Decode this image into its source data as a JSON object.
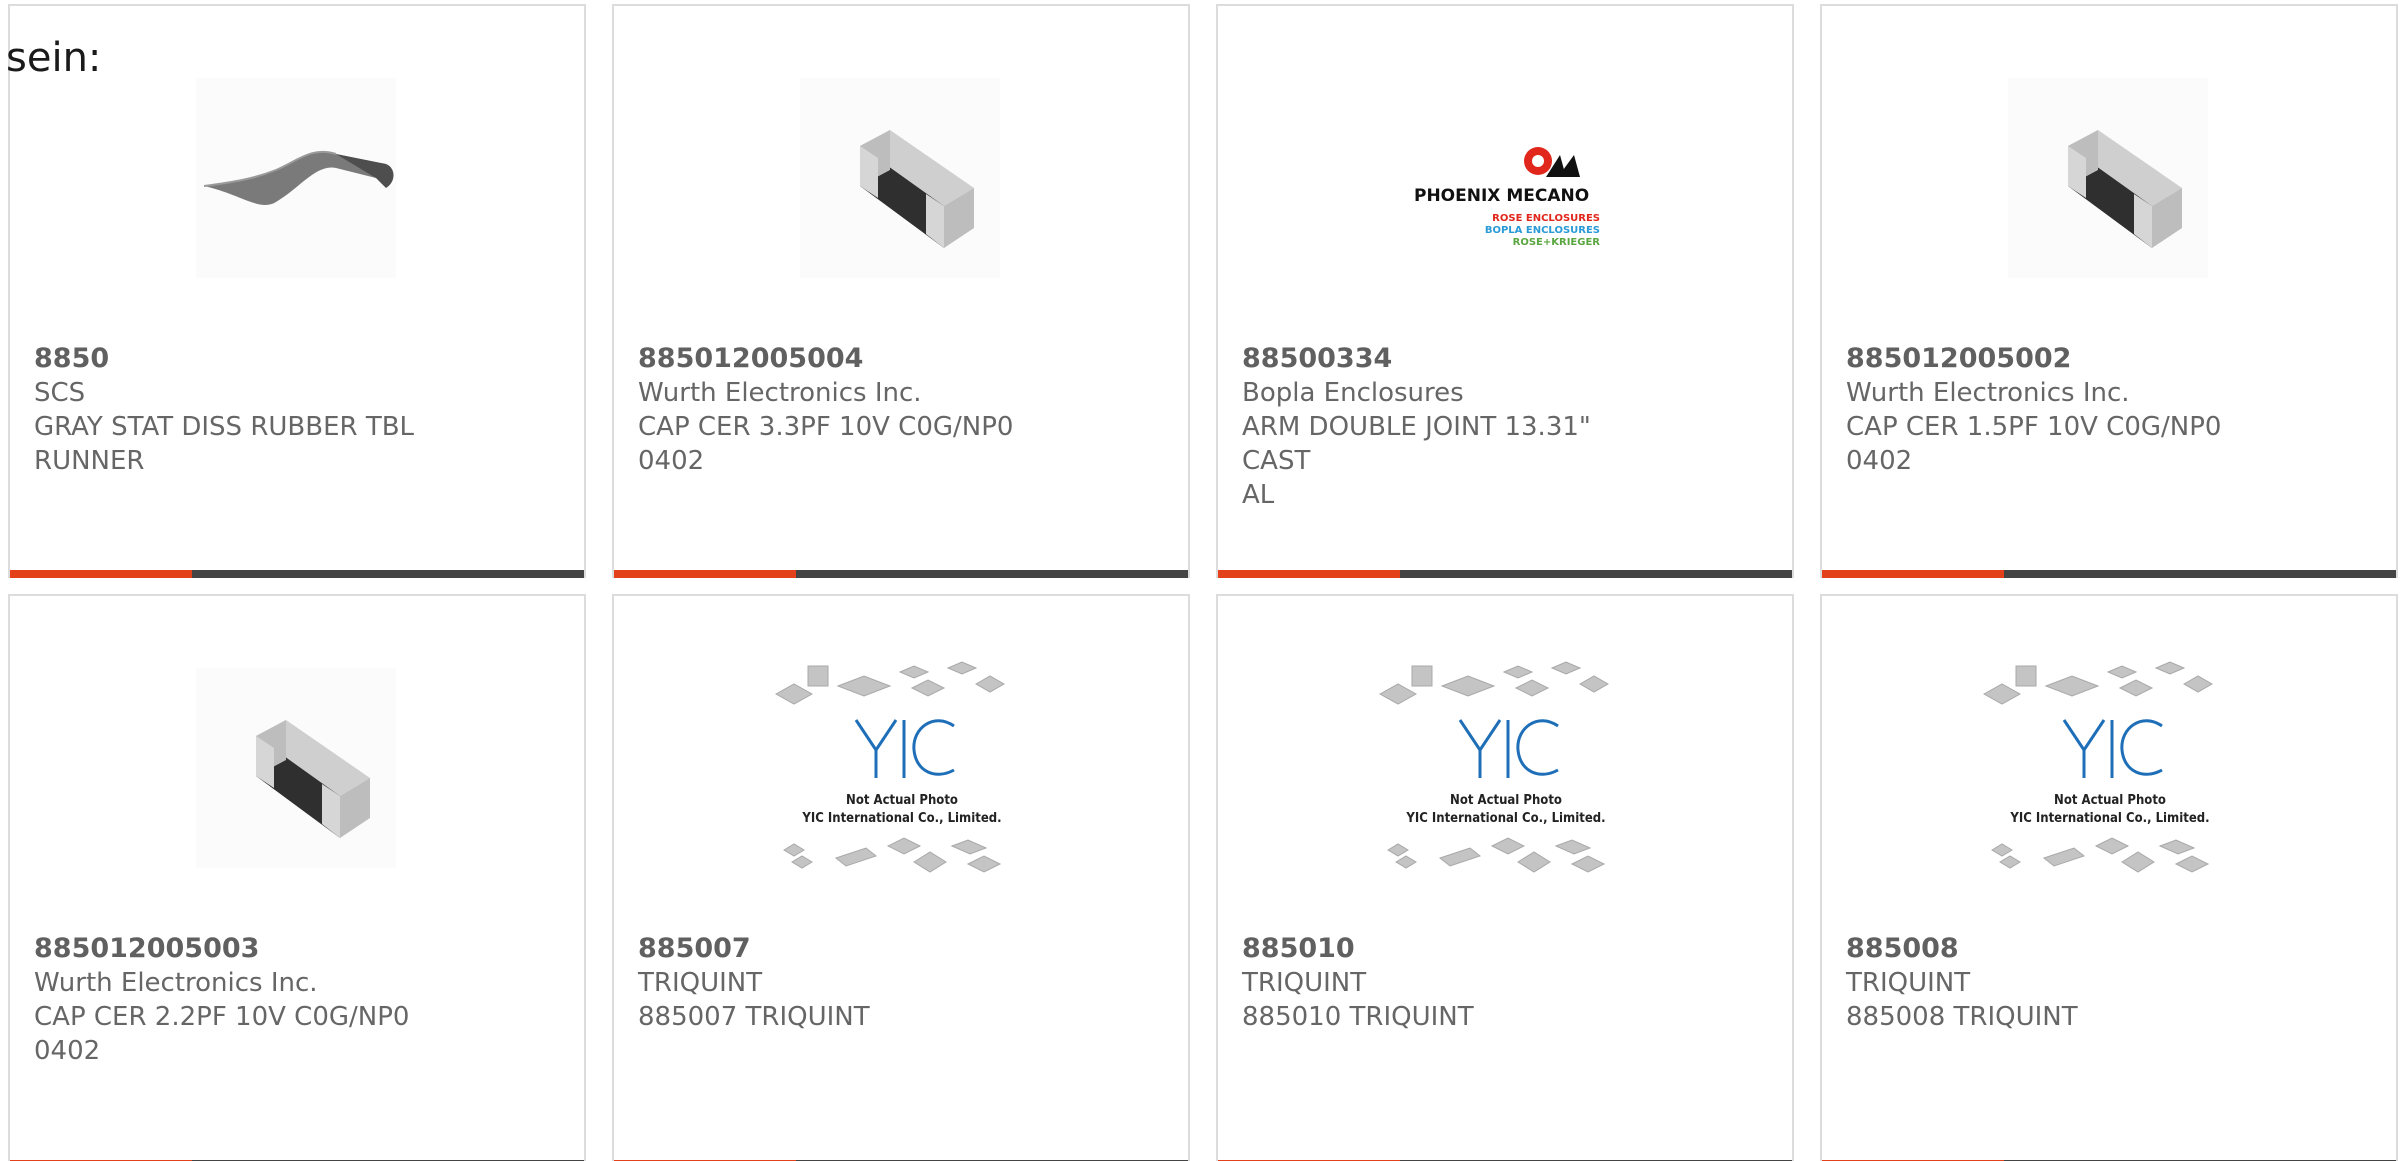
{
  "lead_text": "sein:",
  "colors": {
    "accent": "#e2411a",
    "bar_dark": "#444444",
    "text": "#666666",
    "border": "#dcdcdc"
  },
  "products": [
    {
      "part": "8850",
      "maker": "SCS",
      "desc_line1": "GRAY STAT DISS RUBBER TBL",
      "desc_line2": "RUNNER",
      "image": "rubber-mat-icon"
    },
    {
      "part": "885012005004",
      "maker": "Wurth Electronics Inc.",
      "desc_line1": "CAP CER 3.3PF 10V C0G/NP0",
      "desc_line2": "0402",
      "image": "smd-capacitor-icon"
    },
    {
      "part": "88500334",
      "maker": "Bopla Enclosures",
      "desc_line1": "ARM DOUBLE JOINT 13.31\" CAST",
      "desc_line2": "AL",
      "image": "phoenix-mecano-logo",
      "logo": {
        "brand": "PHOENIX MECANO",
        "line1": "ROSE ENCLOSURES",
        "line2": "BOPLA ENCLOSURES",
        "line3": "ROSE+KRIEGER"
      }
    },
    {
      "part": "885012005002",
      "maker": "Wurth Electronics Inc.",
      "desc_line1": "CAP CER 1.5PF 10V C0G/NP0",
      "desc_line2": "0402",
      "image": "smd-capacitor-icon"
    },
    {
      "part": "885012005003",
      "maker": "Wurth Electronics Inc.",
      "desc_line1": "CAP CER 2.2PF 10V C0G/NP0",
      "desc_line2": "0402",
      "image": "smd-capacitor-icon"
    },
    {
      "part": "885007",
      "maker": "TRIQUINT",
      "desc_line1": "885007 TRIQUINT",
      "desc_line2": "",
      "image": "yic-placeholder-icon",
      "placeholder": {
        "line1": "Not Actual Photo",
        "line2": "YIC International Co., Limited."
      }
    },
    {
      "part": "885010",
      "maker": "TRIQUINT",
      "desc_line1": "885010 TRIQUINT",
      "desc_line2": "",
      "image": "yic-placeholder-icon",
      "placeholder": {
        "line1": "Not Actual Photo",
        "line2": "YIC International Co., Limited."
      }
    },
    {
      "part": "885008",
      "maker": "TRIQUINT",
      "desc_line1": "885008 TRIQUINT",
      "desc_line2": "",
      "image": "yic-placeholder-icon",
      "placeholder": {
        "line1": "Not Actual Photo",
        "line2": "YIC International Co., Limited."
      }
    }
  ]
}
